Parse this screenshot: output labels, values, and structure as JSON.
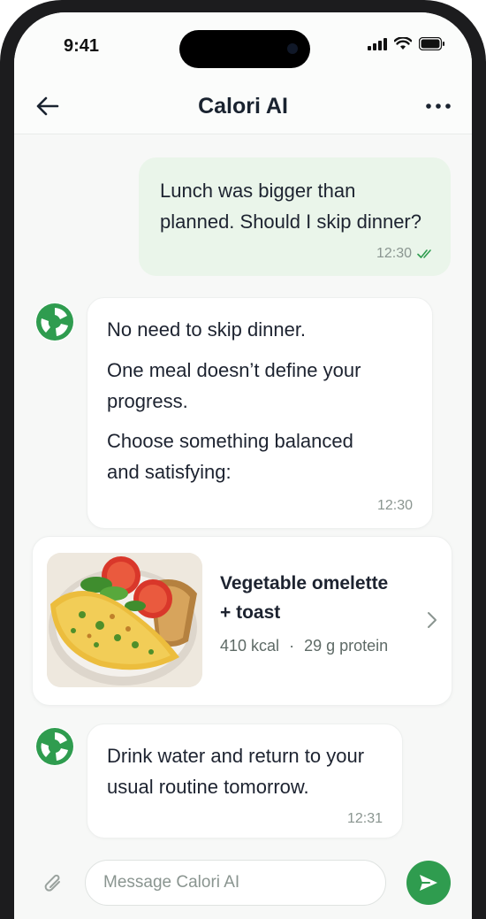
{
  "status": {
    "time": "9:41"
  },
  "header": {
    "title": "Calori AI"
  },
  "messages": {
    "user1": {
      "text_line1": "Lunch was bigger than",
      "text_line2": "planned. Should I skip dinner?",
      "time": "12:30"
    },
    "ai1": {
      "line1": "No need to skip dinner.",
      "line2a": "One meal doesn’t define your",
      "line2b": "progress.",
      "line3a": "Choose something balanced",
      "line3b": "and satisfying:",
      "time": "12:30"
    },
    "card": {
      "name_line1": "Vegetable omelette",
      "name_line2": "+ toast",
      "kcal": "410 kcal",
      "separator": "·",
      "protein": "29 g protein"
    },
    "ai2": {
      "line1": "Drink water and return to your",
      "line2": "usual routine tomorrow.",
      "time": "12:31"
    }
  },
  "composer": {
    "placeholder": "Message Calori AI"
  },
  "colors": {
    "accent": "#2f9c4f",
    "user_bubble": "#eaf5ea",
    "background": "#f7f8f7"
  },
  "icons": [
    "back-arrow-icon",
    "more-icon",
    "logo-icon",
    "read-checks-icon",
    "chevron-right-icon",
    "attach-icon",
    "send-icon"
  ]
}
